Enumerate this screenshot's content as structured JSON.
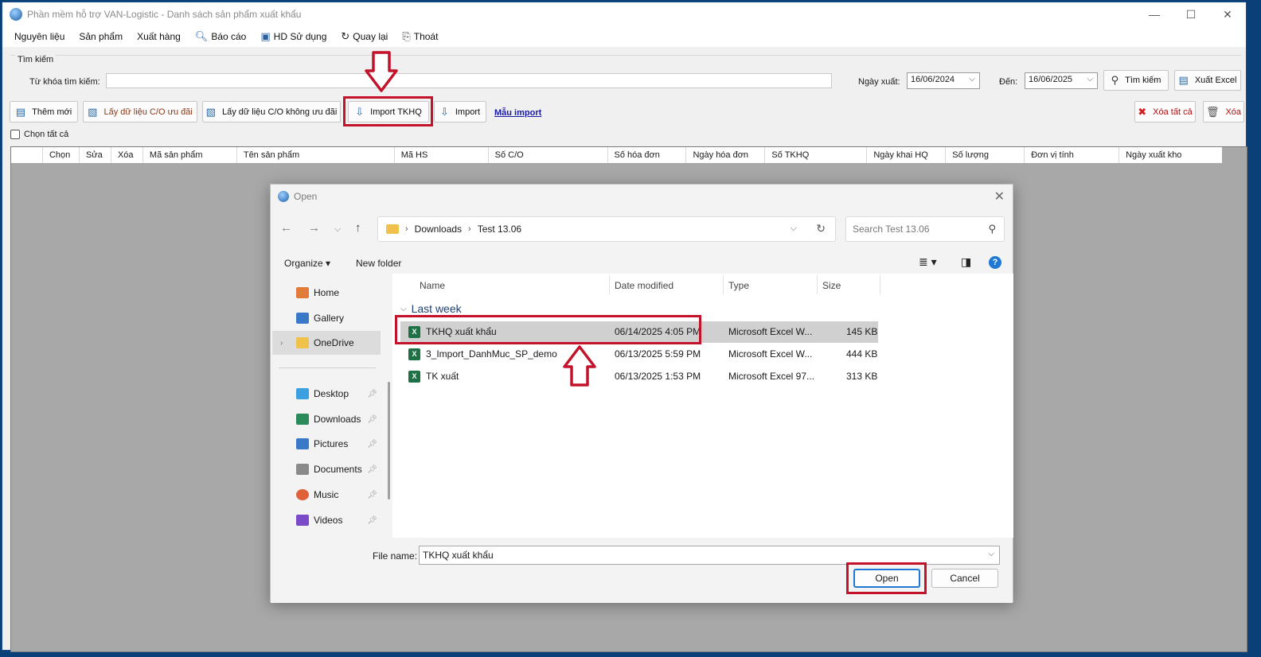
{
  "window": {
    "title": "Phần mềm hỗ trợ VAN-Logistic - Danh sách sản phẩm xuất khẩu",
    "controls": {
      "minimize": "—",
      "maximize": "☐",
      "close": "✕"
    }
  },
  "menu": [
    {
      "label": "Nguyên liệu",
      "icon": ""
    },
    {
      "label": "Sản phẩm",
      "icon": ""
    },
    {
      "label": "Xuất hàng",
      "icon": ""
    },
    {
      "label": "Báo cáo",
      "icon": "search-icon"
    },
    {
      "label": "HD Sử dụng",
      "icon": "help-doc-icon"
    },
    {
      "label": "Quay lại",
      "icon": "refresh-icon"
    },
    {
      "label": "Thoát",
      "icon": "exit-icon"
    }
  ],
  "search": {
    "group_title": "Tìm kiếm",
    "keyword_label": "Từ khóa tìm kiếm:",
    "keyword_value": "",
    "date_from_label": "Ngày xuất:",
    "date_from": "16/06/2024",
    "date_to_label": "Đến:",
    "date_to": "16/06/2025",
    "search_button": "Tìm kiếm",
    "export_button": "Xuất Excel"
  },
  "toolbar": {
    "add": "Thêm mới",
    "co_preferential": "Lấy dữ liệu C/O ưu đãi",
    "co_non_preferential": "Lấy dữ liệu C/O không ưu đãi",
    "import_tkhq": "Import TKHQ",
    "import": "Import",
    "template_link": "Mẫu import",
    "delete_all": "Xóa tất cả",
    "delete": "Xóa"
  },
  "select_all": "Chọn tất cả",
  "grid": {
    "columns": [
      "Chọn",
      "Sửa",
      "Xóa",
      "Mã sản phẩm",
      "Tên sản phẩm",
      "Mã HS",
      "Số C/O",
      "Số hóa đơn",
      "Ngày hóa đơn",
      "Số TKHQ",
      "Ngày khai HQ",
      "Số lượng",
      "Đơn vị tính",
      "Ngày xuất kho"
    ]
  },
  "dialog": {
    "title": "Open",
    "path": [
      "Downloads",
      "Test 13.06"
    ],
    "search_placeholder": "Search Test 13.06",
    "organize": "Organize ▾",
    "new_folder": "New folder",
    "nav": [
      {
        "label": "Home",
        "color": "#e07b39"
      },
      {
        "label": "Gallery",
        "color": "#3a78c8"
      },
      {
        "label": "OneDrive",
        "color": "#f0c24b"
      },
      {
        "label": "Desktop",
        "color": "#3aa0e0"
      },
      {
        "label": "Downloads",
        "color": "#2a8a5a"
      },
      {
        "label": "Pictures",
        "color": "#3a78c8"
      },
      {
        "label": "Documents",
        "color": "#8a8a8a"
      },
      {
        "label": "Music",
        "color": "#e0603a"
      },
      {
        "label": "Videos",
        "color": "#7a4ac8"
      }
    ],
    "columns": {
      "name": "Name",
      "date": "Date modified",
      "type": "Type",
      "size": "Size"
    },
    "group": "Last week",
    "files": [
      {
        "name": "TKHQ xuất khẩu",
        "date": "06/14/2025 4:05 PM",
        "type": "Microsoft Excel W...",
        "size": "145 KB"
      },
      {
        "name": "3_Import_DanhMuc_SP_demo",
        "date": "06/13/2025 5:59 PM",
        "type": "Microsoft Excel W...",
        "size": "444 KB"
      },
      {
        "name": "TK xuất",
        "date": "06/13/2025 1:53 PM",
        "type": "Microsoft Excel 97...",
        "size": "313 KB"
      }
    ],
    "file_name_label": "File name:",
    "file_name_value": "TKHQ xuất khẩu",
    "open_button": "Open",
    "cancel_button": "Cancel"
  },
  "colors": {
    "highlight": "#c4122a",
    "accent": "#2a6aa8"
  }
}
